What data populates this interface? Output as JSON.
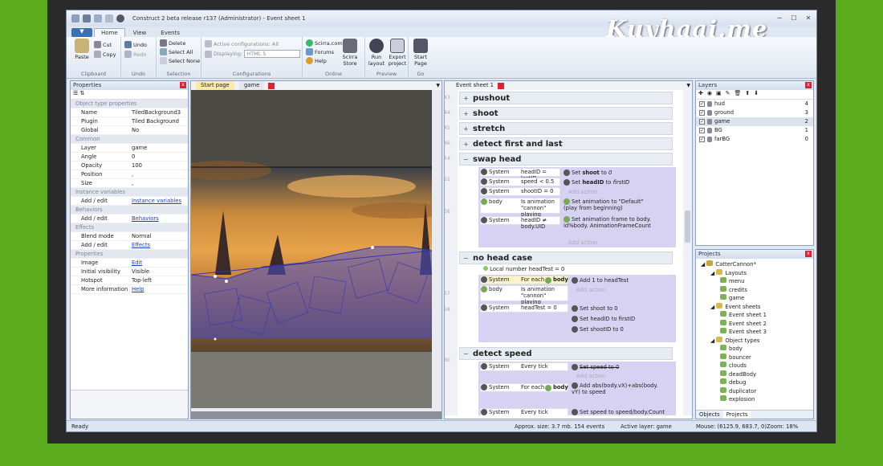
{
  "window": {
    "title": "Construct 2 beta release r137 (Administrator) - Event sheet 1",
    "watermark": "Kuyhaai.me"
  },
  "ribbon": {
    "file_label": "▼",
    "tabs": [
      "Home",
      "View",
      "Events"
    ],
    "clipboard": {
      "paste": "Paste",
      "cut": "Cut",
      "copy": "Copy",
      "label": "Clipboard"
    },
    "undo": {
      "undo": "Undo",
      "redo": "Redo",
      "label": "Undo"
    },
    "selection": {
      "delete": "Delete",
      "select_all": "Select All",
      "select_none": "Select None",
      "label": "Selection"
    },
    "configurations": {
      "active": "Active configurations: All",
      "displaying": "Displaying:",
      "displaying_value": "HTML 5",
      "label": "Configurations"
    },
    "online": {
      "scirra": "Scirra.com",
      "forums": "Forums",
      "help": "Help",
      "store": "Scirra Store",
      "label": "Online"
    },
    "preview": {
      "run": "Run layout",
      "export": "Export project",
      "label": "Preview"
    },
    "go": {
      "start": "Start Page",
      "label": "Go"
    }
  },
  "properties": {
    "header": "Properties",
    "rows": [
      {
        "cat": "Object type properties"
      },
      {
        "k": "Name",
        "v": "TiledBackground3"
      },
      {
        "k": "Plugin",
        "v": "Tiled Background"
      },
      {
        "k": "Global",
        "v": "No"
      },
      {
        "cat": "Common"
      },
      {
        "k": "Layer",
        "v": "game"
      },
      {
        "k": "Angle",
        "v": "0"
      },
      {
        "k": "Opacity",
        "v": "100"
      },
      {
        "k": "Position",
        "v": ","
      },
      {
        "k": "Size",
        "v": ","
      },
      {
        "cat": "Instance variables"
      },
      {
        "k": "Add / edit",
        "v": "Instance variables",
        "link": true
      },
      {
        "cat": "Behaviors"
      },
      {
        "k": "Add / edit",
        "v": "Behaviors",
        "link": true
      },
      {
        "cat": "Effects"
      },
      {
        "k": "Blend mode",
        "v": "Normal"
      },
      {
        "k": "Add / edit",
        "v": "Effects",
        "link": true
      },
      {
        "cat": "Properties"
      },
      {
        "k": "Image",
        "v": "Edit",
        "link": true
      },
      {
        "k": "Initial visibility",
        "v": "Visible"
      },
      {
        "k": "Hotspot",
        "v": "Top-left"
      },
      {
        "k": "More information",
        "v": "Help",
        "link": true
      }
    ]
  },
  "layout_tabs": [
    "Start page",
    "game"
  ],
  "eventsheet": {
    "tab": "Event sheet 1",
    "groups": {
      "pushout": "pushout",
      "shoot": "shoot",
      "stretch": "stretch",
      "detect": "detect first and last",
      "swap": "swap head",
      "nohead": "no head case",
      "speed": "detect speed"
    },
    "line_numbers": [
      "43",
      "44",
      "45",
      "46",
      "54",
      "55",
      "56",
      "57",
      "58",
      "59",
      "60"
    ],
    "rows": {
      "r1c": [
        "System",
        "headID = lastID"
      ],
      "r1a": [
        "Set ",
        "shoot",
        " to ",
        "0"
      ],
      "r2c": [
        "System",
        "speed < 0.5"
      ],
      "r2a": [
        "Set ",
        "headID",
        " to ",
        "firstID"
      ],
      "r3c": [
        "System",
        "shootID = 0"
      ],
      "r4c": [
        "body",
        "Is animation \"cannon\" playing"
      ],
      "r4a": "Set animation to \"Default\" (play from beginning)",
      "r5c": [
        "System",
        "headID ≠ body.UID"
      ],
      "r5a": "Set animation frame to body. id%body. AnimationFrameCount",
      "add_action": "Add action",
      "local": "Local number headTest = 0",
      "n1c": [
        "System",
        "For each",
        "body"
      ],
      "n1a": "Add 1 to headTest",
      "n2c": [
        "body",
        "Is animation \"cannon\" playing"
      ],
      "n3c": [
        "System",
        "headTest = 0"
      ],
      "n3a": [
        "Set shoot to 0",
        "Set headID to firstID",
        "Set shootID to 0"
      ],
      "d1c": [
        "System",
        "Every tick"
      ],
      "d1a": "Set speed to 0",
      "d2c": [
        "System",
        "For each",
        "body"
      ],
      "d2a": "Add abs(body.vX)+abs(body. vY) to speed",
      "d3c": [
        "System",
        "Every tick"
      ],
      "d3a": "Set speed to speed/body.Count"
    }
  },
  "layers": {
    "header": "Layers",
    "items": [
      {
        "name": "hud",
        "n": "4"
      },
      {
        "name": "ground",
        "n": "3"
      },
      {
        "name": "game",
        "n": "2"
      },
      {
        "name": "BG",
        "n": "1"
      },
      {
        "name": "farBG",
        "n": "0"
      }
    ]
  },
  "projects": {
    "header": "Projects",
    "items": [
      {
        "t": "CatterCannon*",
        "d": 0
      },
      {
        "t": "Layouts",
        "d": 1
      },
      {
        "t": "menu",
        "d": 2
      },
      {
        "t": "credits",
        "d": 2
      },
      {
        "t": "game",
        "d": 2
      },
      {
        "t": "Event sheets",
        "d": 1
      },
      {
        "t": "Event sheet 1",
        "d": 2
      },
      {
        "t": "Event sheet 2",
        "d": 2
      },
      {
        "t": "Event sheet 3",
        "d": 2
      },
      {
        "t": "Object types",
        "d": 1
      },
      {
        "t": "body",
        "d": 2
      },
      {
        "t": "bouncer",
        "d": 2
      },
      {
        "t": "clouds",
        "d": 2
      },
      {
        "t": "deadBody",
        "d": 2
      },
      {
        "t": "debug",
        "d": 2
      },
      {
        "t": "duplicator",
        "d": 2
      },
      {
        "t": "explosion",
        "d": 2
      }
    ],
    "tabs": [
      "Objects",
      "Projects"
    ]
  },
  "status": {
    "ready": "Ready",
    "size": "Approx. size: 3.7 mb. 154 events",
    "layer": "Active layer: game",
    "mouse": "Mouse: (6125.9, 683.7, 0)",
    "zoom": "Zoom: 18%"
  }
}
